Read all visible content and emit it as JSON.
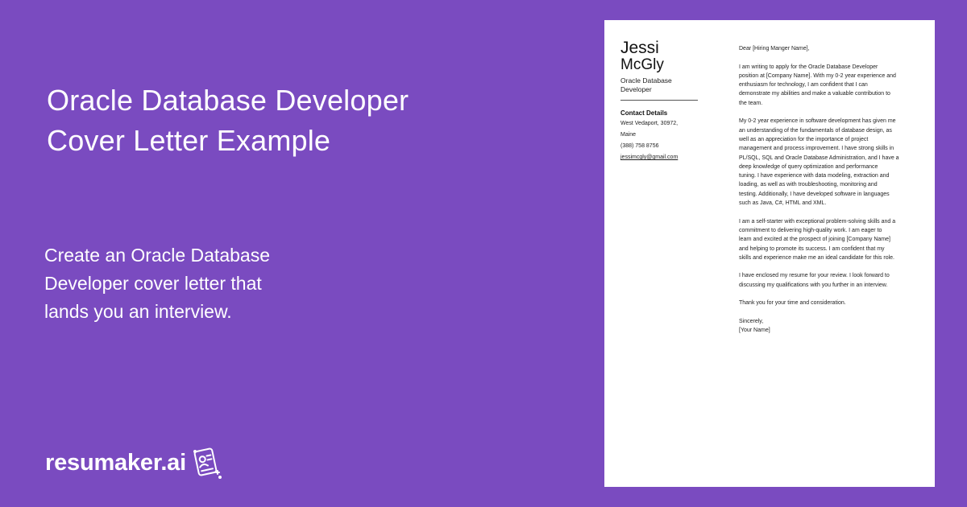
{
  "hero": {
    "title_lines": [
      "Oracle Database Developer",
      "Cover Letter Example"
    ],
    "subtitle_lines": [
      "Create an Oracle Database",
      "Developer cover letter that",
      "lands you an interview."
    ]
  },
  "brand": {
    "name": "resumaker.ai",
    "icon": "resume-document-icon"
  },
  "letter": {
    "first_name": "Jessi",
    "last_name": "McGly",
    "job_title_lines": [
      "Oracle Database",
      "Developer"
    ],
    "contact_heading": "Contact Details",
    "address_lines": [
      "West Vedaport, 30972,",
      "Maine"
    ],
    "phone": "(388) 758 8756",
    "email": "jessimcgly@gmail.com",
    "greeting": "Dear [Hiring Manger Name],",
    "paragraph_1": [
      "I am writing to apply for the Oracle Database Developer",
      "position at [Company Name]. With my 0-2 year experience and",
      "enthusiasm for technology, I am confident that I can",
      "demonstrate my abilities and make a valuable contribution to",
      "the team."
    ],
    "paragraph_2": [
      "My 0-2 year experience in software development has given me",
      "an understanding of the fundamentals of database design, as",
      "well as an appreciation for the importance of project",
      "management and process improvement. I have strong skills in",
      "PL/SQL, SQL and Oracle Database Administration, and I have a",
      "deep knowledge of query optimization and performance",
      "tuning. I have experience with data modeling, extraction and",
      "loading, as well as with troubleshooting, monitoring and",
      "testing. Additionally, I have developed software in languages",
      "such as Java, C#, HTML and XML."
    ],
    "paragraph_3": [
      "I am a self-starter with exceptional problem-solving skills and a",
      "commitment to delivering high-quality work. I am eager to",
      "learn and excited at the prospect of joining [Company Name]",
      "and helping to promote its success. I am confident that my",
      "skills and experience make me an ideal candidate for this role."
    ],
    "paragraph_4": [
      "I have enclosed my resume for your review. I look forward to",
      "discussing my qualifications with you further in an interview."
    ],
    "paragraph_5": "Thank you for your time and consideration.",
    "closing": "Sincerely,",
    "signature": "[Your Name]"
  },
  "colors": {
    "background": "#7a4bc0",
    "text_light": "#ffffff",
    "page": "#ffffff",
    "text_dark": "#222222"
  }
}
